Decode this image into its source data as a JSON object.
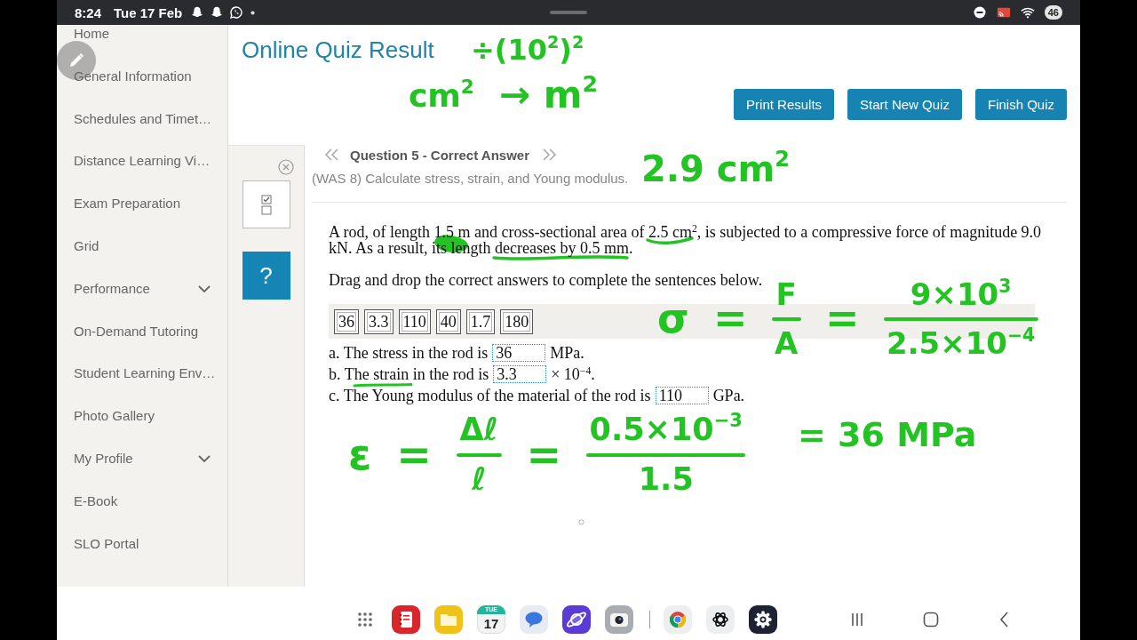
{
  "status_bar": {
    "time": "8:24",
    "date": "Tue 17 Feb",
    "battery": "46"
  },
  "sidebar": {
    "items": [
      {
        "label": "Home",
        "has_submenu": false
      },
      {
        "label": "General Information",
        "has_submenu": false
      },
      {
        "label": "Schedules and Timet…",
        "has_submenu": false
      },
      {
        "label": "Distance Learning Vi…",
        "has_submenu": false
      },
      {
        "label": "Exam Preparation",
        "has_submenu": false
      },
      {
        "label": "Grid",
        "has_submenu": false
      },
      {
        "label": "Performance",
        "has_submenu": true
      },
      {
        "label": "On-Demand Tutoring",
        "has_submenu": false
      },
      {
        "label": "Student Learning Env…",
        "has_submenu": false
      },
      {
        "label": "Photo Gallery",
        "has_submenu": false
      },
      {
        "label": "My Profile",
        "has_submenu": true
      },
      {
        "label": "E-Book",
        "has_submenu": false
      },
      {
        "label": "SLO Portal",
        "has_submenu": false
      }
    ]
  },
  "header": {
    "title": "Online Quiz Result",
    "buttons": [
      "Print Results",
      "Start New Quiz",
      "Finish Quiz"
    ]
  },
  "tool_panel": {
    "help_label": "?"
  },
  "question": {
    "heading": "Question 5 - Correct Answer",
    "subtitle": "(WAS 8) Calculate stress, strain, and Young modulus.",
    "prompt": "A rod, of length 1.5 m and cross-sectional area of 2.5 cm$^{2}$, is subjected to a compressive force of magnitude 9.0 kN. As a result, its length decreases by 0.5 mm.",
    "instruction": "Drag and drop the correct answers to complete the sentences below.",
    "answer_choices": [
      "36",
      "3.3",
      "110",
      "40",
      "1.7",
      "180"
    ],
    "sentences": [
      {
        "before": "a. The stress in the rod is",
        "answer": "36",
        "after": "MPa."
      },
      {
        "before": "b. The strain in the rod is",
        "answer": "3.3",
        "after": "× 10$^{−4}$."
      },
      {
        "before": "c. The Young modulus of the material of the rod is",
        "answer": "110",
        "after": "GPa."
      }
    ]
  },
  "ink_annotations": [
    {
      "kind": "text",
      "text": "cm$^{2}$"
    },
    {
      "kind": "text",
      "text": "÷(10$^{2}$)$^{2}$"
    },
    {
      "kind": "text",
      "text": "→ m$^{2}$"
    },
    {
      "kind": "text",
      "text": "2.9 cm$^{2}$"
    },
    {
      "kind": "equation",
      "terms": [
        {
          "kind": "symbol",
          "text": "σ"
        },
        {
          "kind": "symbol",
          "text": "="
        },
        {
          "kind": "fraction",
          "numerator": "F",
          "denominator": "A"
        },
        {
          "kind": "symbol",
          "text": "="
        },
        {
          "kind": "fraction",
          "numerator": "9×10$^{3}$",
          "denominator": "2.5×10$^{−4}$"
        }
      ]
    },
    {
      "kind": "equation",
      "terms": [
        {
          "kind": "symbol",
          "text": "ε"
        },
        {
          "kind": "symbol",
          "text": "="
        },
        {
          "kind": "fraction",
          "numerator": "Δℓ",
          "denominator": "ℓ"
        },
        {
          "kind": "symbol",
          "text": "="
        },
        {
          "kind": "fraction",
          "numerator": "0.5×10$^{−3}$",
          "denominator": "1.5"
        }
      ]
    },
    {
      "kind": "text",
      "text": "= 36 MPa"
    }
  ],
  "dock": {
    "apps": [
      {
        "kind": "app-grid"
      },
      {
        "kind": "notes"
      },
      {
        "kind": "files"
      },
      {
        "kind": "calendar",
        "weekday": "TUE",
        "day": "17"
      },
      {
        "kind": "messages"
      },
      {
        "kind": "planet-browser"
      },
      {
        "kind": "camera"
      },
      {
        "kind": "separator"
      },
      {
        "kind": "circle-browser"
      },
      {
        "kind": "assistant"
      },
      {
        "kind": "settings"
      }
    ]
  }
}
